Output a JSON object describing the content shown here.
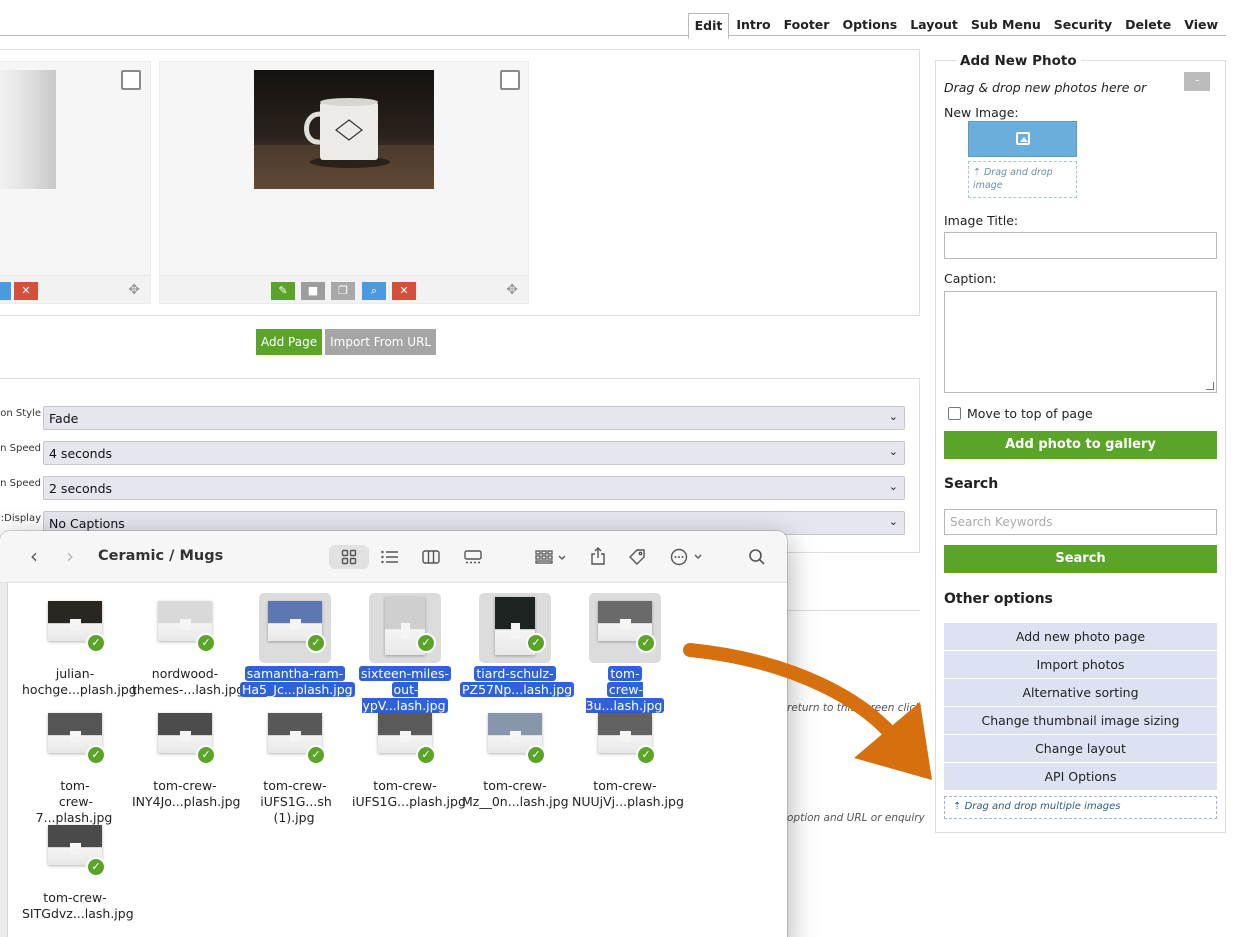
{
  "tabs": [
    "Edit",
    "Intro",
    "Footer",
    "Options",
    "Layout",
    "Sub Menu",
    "Security",
    "Delete",
    "View"
  ],
  "active_tab": "Edit",
  "page_buttons": {
    "add_page": "Add Page",
    "import_url": "Import From URL"
  },
  "settings": {
    "rows": [
      {
        "label": "on Style:",
        "value": "Fade"
      },
      {
        "label": "n Speed:",
        "value": "4 seconds"
      },
      {
        "label": "n Speed:",
        "value": "2 seconds"
      },
      {
        "label": "Display:",
        "value": "No Captions"
      }
    ]
  },
  "background_notes": {
    "note1": "return to this screen click",
    "note2": "option and URL or enquiry"
  },
  "sidebar": {
    "title": "Add New Photo",
    "drag_text": "Drag & drop new photos here or",
    "collapse": "–",
    "new_image_label": "New Image:",
    "drop_image": "Drag and drop image",
    "image_title_label": "Image Title:",
    "caption_label": "Caption:",
    "move_top": "Move to top of page",
    "add_photo": "Add photo to gallery",
    "search_heading": "Search",
    "search_placeholder": "Search Keywords",
    "search_button": "Search",
    "other_heading": "Other options",
    "options": [
      "Add new photo page",
      "Import photos",
      "Alternative sorting",
      "Change thumbnail image sizing",
      "Change layout",
      "API Options"
    ],
    "multi_drop": "Drag and drop multiple images"
  },
  "finder": {
    "path": "Ceramic / Mugs",
    "files": [
      {
        "line1": "julian-",
        "line2": "hochge...plash.jpg",
        "selected": false,
        "color": "#2a2622",
        "tall": false
      },
      {
        "line1": "nordwood-",
        "line2": "themes-...lash.jpg",
        "selected": false,
        "color": "#d9d9d9",
        "tall": false
      },
      {
        "line1": "samantha-ram-",
        "line2": "Ha5_Jc...plash.jpg",
        "selected": true,
        "color": "#5d77b0",
        "tall": false
      },
      {
        "line1": "sixteen-miles-",
        "line2": "out-ypV...lash.jpg",
        "selected": true,
        "color": "#cfcfcf",
        "tall": true
      },
      {
        "line1": "tiard-schulz-",
        "line2": "PZ57Np...lash.jpg",
        "selected": true,
        "color": "#1e2422",
        "tall": true
      },
      {
        "line1": "tom-",
        "line2": "crew-3u...lash.jpg",
        "selected": true,
        "color": "#6a6a6a",
        "tall": false
      },
      {
        "line1": "tom-",
        "line2": "crew-7...plash.jpg",
        "selected": false,
        "color": "#555555",
        "tall": false
      },
      {
        "line1": "tom-crew-",
        "line2": "INY4Jo...plash.jpg",
        "selected": false,
        "color": "#4c4c4c",
        "tall": false
      },
      {
        "line1": "tom-crew-",
        "line2": "iUFS1G...sh (1).jpg",
        "selected": false,
        "color": "#585858",
        "tall": false
      },
      {
        "line1": "tom-crew-",
        "line2": "iUFS1G...plash.jpg",
        "selected": false,
        "color": "#5a5a5a",
        "tall": false
      },
      {
        "line1": "tom-crew-",
        "line2": "Mz__0n...lash.jpg",
        "selected": false,
        "color": "#8796ab",
        "tall": false
      },
      {
        "line1": "tom-crew-",
        "line2": "NUUjVj...plash.jpg",
        "selected": false,
        "color": "#626262",
        "tall": false
      },
      {
        "line1": "tom-crew-",
        "line2": "SITGdvz...lash.jpg",
        "selected": false,
        "color": "#4a4a4a",
        "tall": false
      }
    ]
  },
  "colors": {
    "green": "#5aa427",
    "blue": "#6caedb",
    "selection": "#2f62d6",
    "arrow": "#d6700e",
    "option_bg": "#dde2f2"
  }
}
